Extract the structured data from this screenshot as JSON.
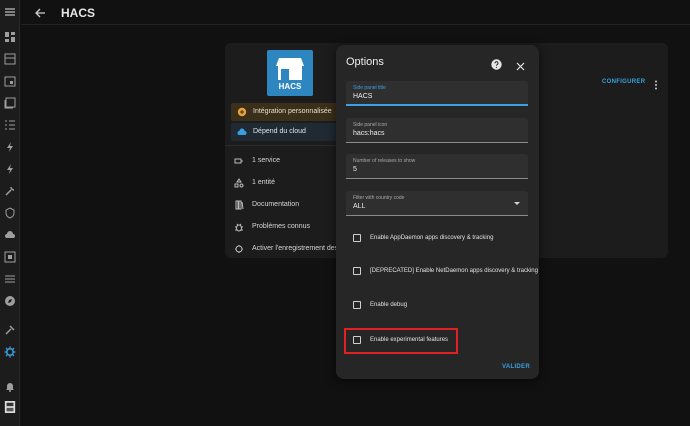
{
  "topbar": {
    "title": "HACS"
  },
  "sidebar": {
    "items": [
      "menu-icon",
      "overview-icon",
      "dashboard-icon",
      "calendar-icon",
      "media-icon",
      "todo-icon",
      "energy-icon",
      "lightning-icon",
      "tools-icon",
      "shield-icon",
      "cloud-icon",
      "ports-icon",
      "history-icon",
      "compass-icon",
      "hammer-icon",
      "gear-icon",
      "bell-icon",
      "avatar-icon"
    ]
  },
  "card": {
    "logo_text": "HACS",
    "chip_custom": "Intégration personnalisée",
    "chip_cloud": "Dépend du cloud",
    "items": [
      {
        "label": "1 service"
      },
      {
        "label": "1 entité"
      },
      {
        "label": "Documentation"
      },
      {
        "label": "Problèmes connus"
      },
      {
        "label": "Activer l'enregistrement des jo"
      }
    ],
    "configurer": "CONFIGURER"
  },
  "dialog": {
    "title": "Options",
    "fields": [
      {
        "label": "Side panel title",
        "value": "HACS"
      },
      {
        "label": "Side panel icon",
        "value": "hacs:hacs"
      },
      {
        "label": "Number of releases to show",
        "value": "5"
      },
      {
        "label": "Filter with country code",
        "value": "ALL"
      }
    ],
    "checkboxes": [
      {
        "label": "Enable AppDaemon apps discovery & tracking",
        "checked": false
      },
      {
        "label": "[DEPRECATED] Enable NetDaemon apps discovery & tracking",
        "checked": false
      },
      {
        "label": "Enable debug",
        "checked": false
      },
      {
        "label": "Enable experimental features",
        "checked": false
      }
    ],
    "submit": "VALIDER"
  },
  "colors": {
    "accent": "#3aa0e0",
    "highlight": "#e02222",
    "custom_chip": "#3a2f1a",
    "cloud_chip": "#1f2a33"
  }
}
